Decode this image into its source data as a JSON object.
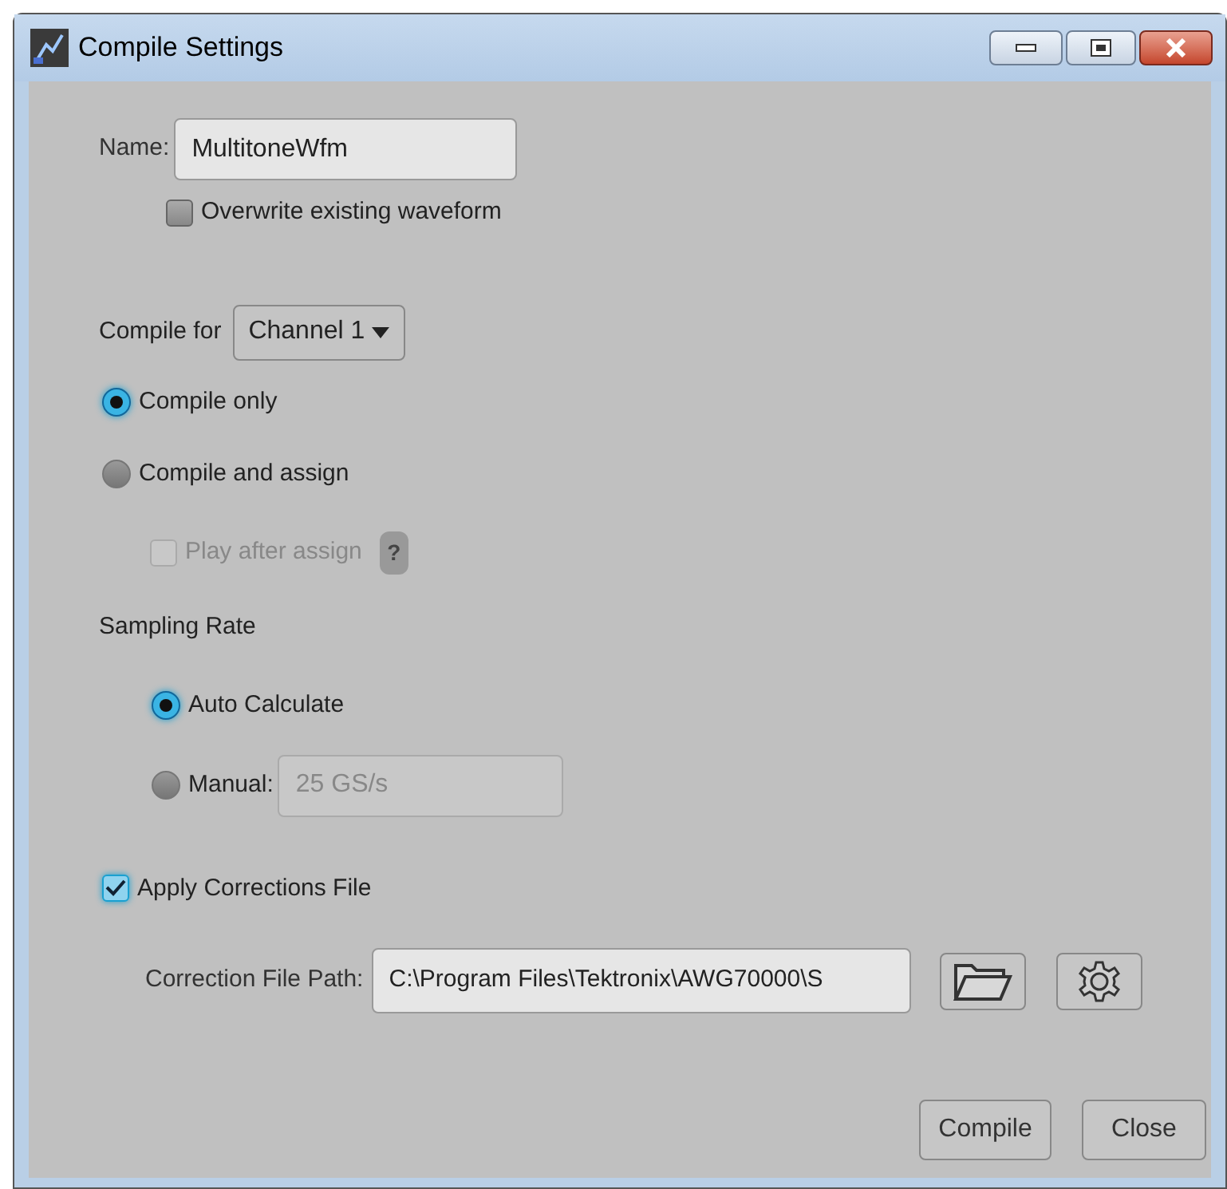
{
  "window": {
    "title": "Compile Settings"
  },
  "name_field": {
    "label": "Name:",
    "value": "MultitoneWfm"
  },
  "overwrite": {
    "label": "Overwrite existing waveform",
    "checked": false,
    "disabled": false
  },
  "compile_for": {
    "label": "Compile for",
    "value": "Channel 1"
  },
  "compile_mode": [
    {
      "label": "Compile only",
      "selected": true
    },
    {
      "label": "Compile and assign",
      "selected": false
    }
  ],
  "play_after_assign": {
    "label": "Play after assign",
    "checked": false,
    "disabled": true,
    "help": "?"
  },
  "sampling_rate": {
    "label": "Sampling Rate",
    "options": [
      {
        "label": "Auto Calculate",
        "selected": true
      },
      {
        "label": "Manual:",
        "selected": false
      }
    ],
    "manual_value": "25 GS/s"
  },
  "apply_corrections": {
    "label": "Apply Corrections File",
    "checked": true,
    "disabled": false
  },
  "correction_path": {
    "label": "Correction File Path:",
    "value": "C:\\Program Files\\Tektronix\\AWG70000\\S"
  },
  "buttons": [
    "Compile",
    "Close"
  ]
}
